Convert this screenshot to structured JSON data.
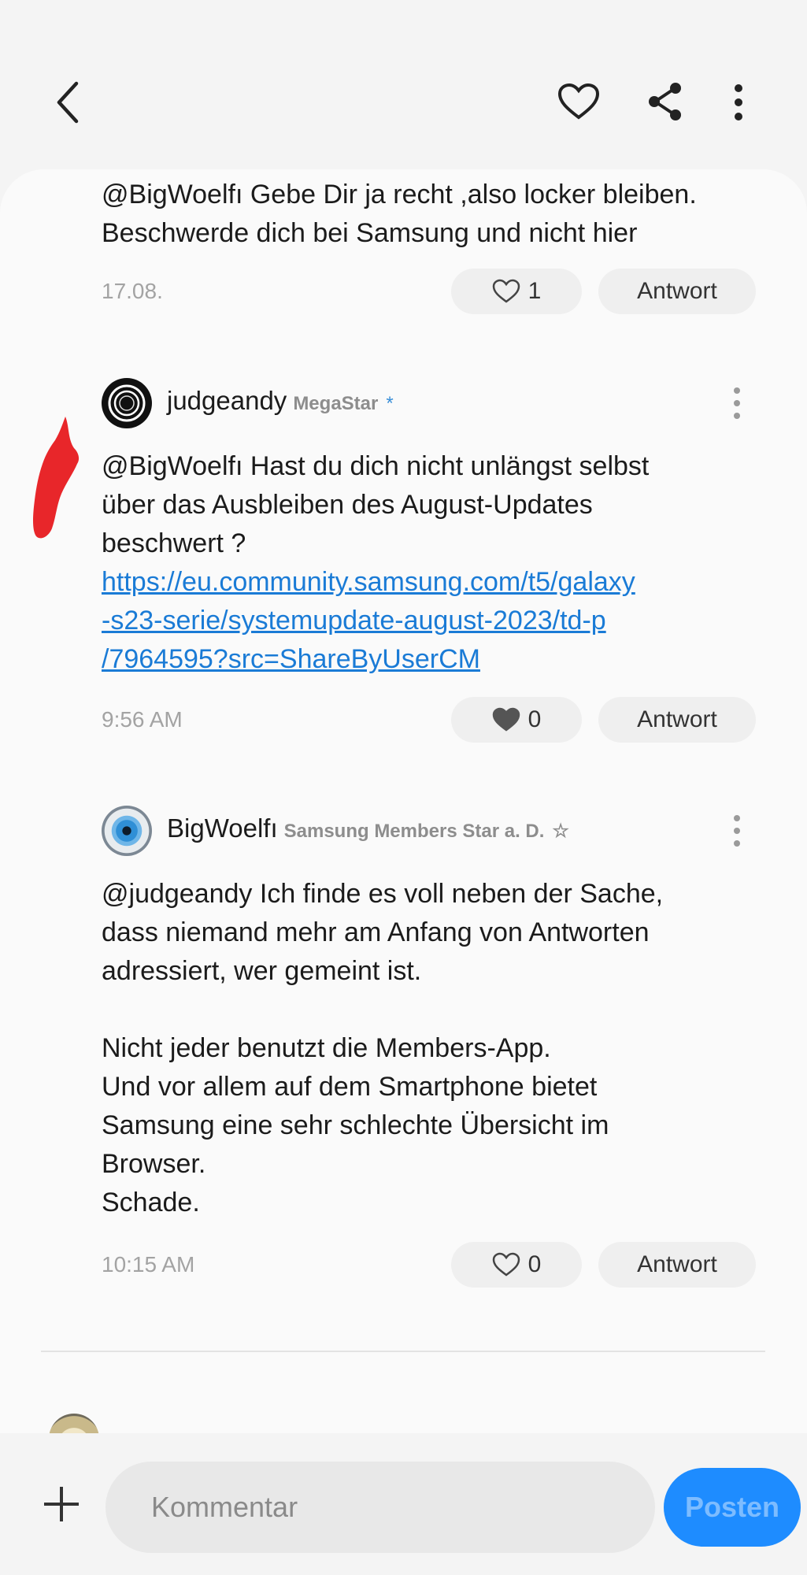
{
  "header": {
    "icons": [
      "back-icon",
      "heart-icon",
      "share-icon",
      "more-icon"
    ]
  },
  "comments": [
    {
      "lines": [
        "@BigWoelfı  Gebe Dir ja recht ,also locker bleiben.",
        "Beschwerde dich bei Samsung und nicht hier"
      ],
      "time": "17.08.",
      "likes": "1",
      "reply_label": "Antwort"
    },
    {
      "username": "judgeandy",
      "rank": "MegaStar",
      "rank_mark": "*",
      "lines": [
        "@BigWoelfı  Hast du dich nicht unlängst selbst",
        "über das Ausbleiben des August-Updates",
        "beschwert ?"
      ],
      "link_lines": [
        "https://eu.community.samsung.com/t5/galaxy",
        "-s23-serie/systemupdate-august-2023/td-p",
        "/7964595?src=ShareByUserCM"
      ],
      "time": "9:56 AM",
      "likes": "0",
      "reply_label": "Antwort"
    },
    {
      "username": "BigWoelfı",
      "rank": "Samsung Members Star a. D.",
      "rank_mark": "☆",
      "lines": [
        "@judgeandy  Ich finde es voll neben der Sache,",
        "dass niemand mehr am Anfang von Antworten",
        "adressiert, wer gemeint ist.",
        "",
        "Nicht jeder benutzt die Members-App.",
        "Und vor allem auf dem Smartphone bietet",
        "Samsung eine sehr schlechte Übersicht im",
        "Browser.",
        "Schade."
      ],
      "time": "10:15 AM",
      "likes": "0",
      "reply_label": "Antwort"
    }
  ],
  "composer": {
    "placeholder": "Kommentar",
    "post_label": "Posten"
  },
  "colors": {
    "link": "#1a7bd6",
    "accent": "#1e8cff",
    "annotation": "#e8262a"
  }
}
